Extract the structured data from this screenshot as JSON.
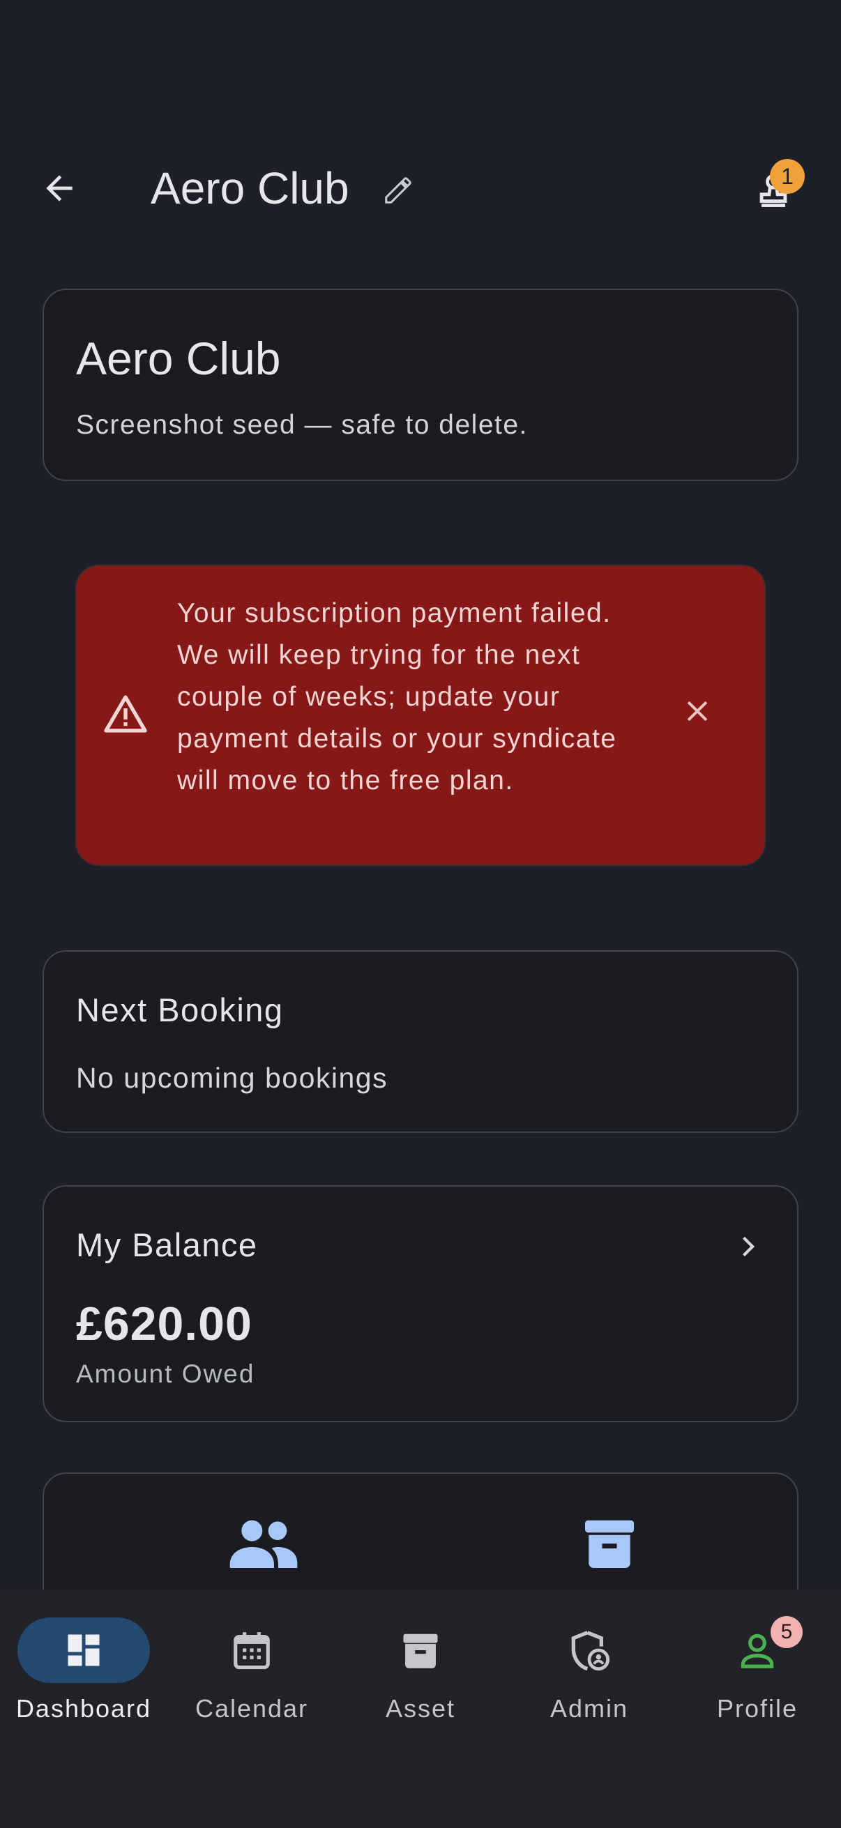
{
  "header": {
    "title": "Aero Club",
    "approvals_badge": "1"
  },
  "club_card": {
    "name": "Aero Club",
    "description": "Screenshot seed — safe to delete."
  },
  "alert": {
    "message": "Your subscription payment failed. We will keep trying for the next couple of weeks; update your payment details or your syndicate will move to the free plan."
  },
  "next_booking": {
    "heading": "Next Booking",
    "empty_text": "No upcoming bookings"
  },
  "balance": {
    "heading": "My Balance",
    "amount": "£620.00",
    "label": "Amount Owed"
  },
  "quick_actions": [
    {
      "icon": "people-icon"
    },
    {
      "icon": "archive-box-icon"
    }
  ],
  "bottom_nav": {
    "items": [
      {
        "label": "Dashboard",
        "icon": "dashboard-icon",
        "active": true
      },
      {
        "label": "Calendar",
        "icon": "calendar-icon"
      },
      {
        "label": "Asset",
        "icon": "archive-box-icon"
      },
      {
        "label": "Admin",
        "icon": "admin-shield-icon"
      },
      {
        "label": "Profile",
        "icon": "person-icon",
        "badge": "5"
      }
    ]
  },
  "colors": {
    "background": "#1d2029",
    "alert_bg": "#861918",
    "accent_blue": "#a8c7fa",
    "badge_orange": "#f0a13a",
    "profile_green": "#4caf50",
    "nav_active_pill": "#244a72"
  }
}
